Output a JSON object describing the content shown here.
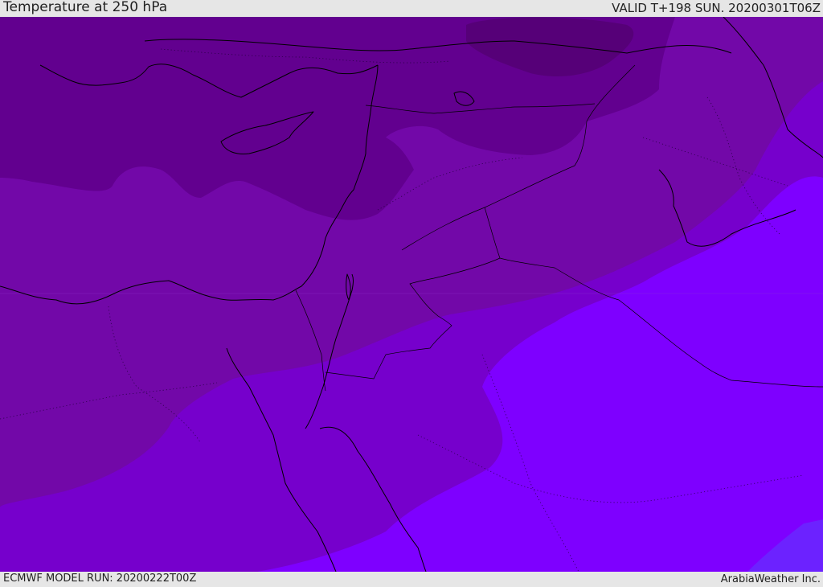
{
  "header": {
    "title": "Temperature at 250 hPa",
    "valid": "VALID T+198 SUN. 20200301T06Z"
  },
  "footer": {
    "model_run": "ECMWF MODEL RUN: 20200222T00Z",
    "credit": "ArabiaWeather Inc."
  },
  "map": {
    "variable": "temperature",
    "level": "250 hPa",
    "palette": {
      "band_darkest": "#560078",
      "band_dark": "#62008f",
      "band_mid": "#7208a8",
      "band_violet": "#7600cc",
      "band_bright": "#7e00ff",
      "band_blue_violet": "#6c22ff",
      "lines": "#000000"
    }
  }
}
